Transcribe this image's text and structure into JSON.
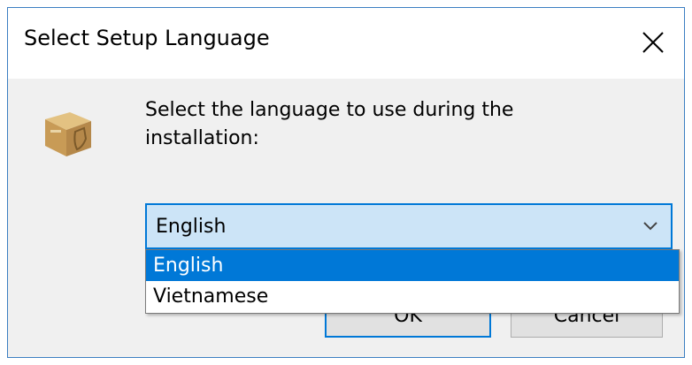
{
  "window": {
    "title": "Select Setup Language",
    "close_symbol": "✕"
  },
  "icons": {
    "app": "setup-package-icon",
    "close": "close-icon",
    "dropdown": "chevron-down-icon"
  },
  "prompt": {
    "line1": "Select the language to use during the",
    "line2": "installation:"
  },
  "language_select": {
    "value": "English",
    "options": [
      {
        "label": "English",
        "selected": true
      },
      {
        "label": "Vietnamese",
        "selected": false
      }
    ]
  },
  "buttons": {
    "ok_label": "OK",
    "cancel_label": "Cancel"
  },
  "colors": {
    "accent": "#0078d7",
    "combo_background": "#cce4f7",
    "dialog_background": "#f0f0f0"
  }
}
